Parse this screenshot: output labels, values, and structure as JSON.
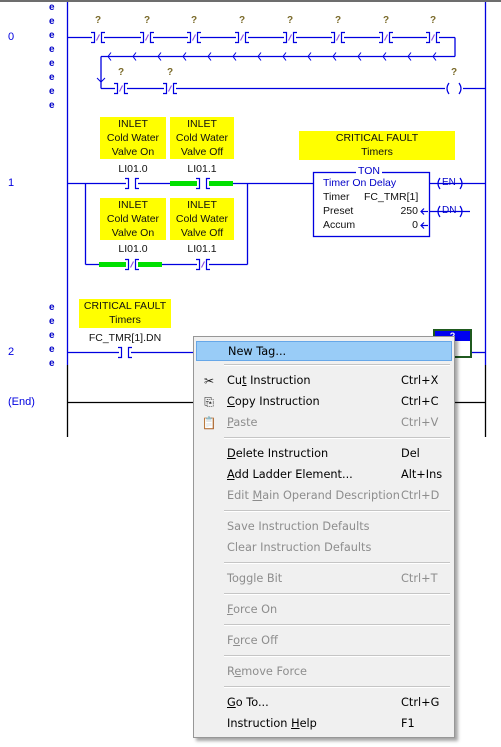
{
  "rungs": [
    {
      "number": "0",
      "error_marks": [
        "e",
        "e",
        "e",
        "e",
        "e",
        "e",
        "e",
        "e"
      ]
    },
    {
      "number": "1"
    },
    {
      "number": "2",
      "error_marks": [
        "e",
        "e",
        "e",
        "e",
        "e"
      ]
    },
    {
      "number": "(End)"
    }
  ],
  "rung0": {
    "top_contacts": [
      "?",
      "?",
      "?",
      "?",
      "?",
      "?",
      "?",
      "?"
    ],
    "bottom_contacts": [
      "?",
      "?"
    ],
    "coil": "?"
  },
  "rung1": {
    "contacts": [
      {
        "desc": [
          "INLET",
          "Cold Water",
          "Valve On"
        ],
        "operand": "LI01.0",
        "type": "XIC"
      },
      {
        "desc": [
          "INLET",
          "Cold Water",
          "Valve Off"
        ],
        "operand": "LI01.1",
        "type": "XIC"
      },
      {
        "desc": [
          "INLET",
          "Cold Water",
          "Valve On"
        ],
        "operand": "LI01.0",
        "type": "XIO"
      },
      {
        "desc": [
          "INLET",
          "Cold Water",
          "Valve Off"
        ],
        "operand": "LI01.1",
        "type": "XIO"
      }
    ],
    "ton": {
      "desc": [
        "CRITICAL FAULT",
        "Timers"
      ],
      "title": "TON",
      "name": "Timer On Delay",
      "timer_label": "Timer",
      "timer_value": "FC_TMR[1]",
      "preset_label": "Preset",
      "preset_value": "250",
      "accum_label": "Accum",
      "accum_value": "0",
      "en": "EN",
      "dn": "DN"
    }
  },
  "rung2": {
    "desc": [
      "CRITICAL FAULT",
      "Timers"
    ],
    "operand": "FC_TMR[1].DN",
    "coil": "?"
  },
  "context_menu": {
    "items": [
      {
        "pre": "New Tag...",
        "ul": "",
        "post": "",
        "shortcut": "",
        "icon": "",
        "disabled": false,
        "highlighted": true
      },
      {
        "pre": "Cu",
        "ul": "t",
        "post": " Instruction",
        "shortcut": "Ctrl+X",
        "icon": "scissors-icon",
        "disabled": false
      },
      {
        "pre": "",
        "ul": "C",
        "post": "opy Instruction",
        "shortcut": "Ctrl+C",
        "icon": "copy-icon",
        "disabled": false
      },
      {
        "pre": "",
        "ul": "P",
        "post": "aste",
        "shortcut": "Ctrl+V",
        "icon": "paste-icon",
        "disabled": true
      },
      {
        "pre": "",
        "ul": "D",
        "post": "elete Instruction",
        "shortcut": "Del",
        "icon": "",
        "disabled": false
      },
      {
        "pre": "",
        "ul": "A",
        "post": "dd Ladder Element...",
        "shortcut": "Alt+Ins",
        "icon": "",
        "disabled": false
      },
      {
        "pre": "Edit ",
        "ul": "M",
        "post": "ain Operand Description",
        "shortcut": "Ctrl+D",
        "icon": "",
        "disabled": true
      },
      {
        "pre": "Save Instruction Defaults",
        "ul": "",
        "post": "",
        "shortcut": "",
        "icon": "",
        "disabled": true
      },
      {
        "pre": "Clear Instruction Defaults",
        "ul": "",
        "post": "",
        "shortcut": "",
        "icon": "",
        "disabled": true
      },
      {
        "pre": "Toggle Bit",
        "ul": "",
        "post": "",
        "shortcut": "Ctrl+T",
        "icon": "",
        "disabled": true
      },
      {
        "pre": "",
        "ul": "F",
        "post": "orce On",
        "shortcut": "",
        "icon": "",
        "disabled": true
      },
      {
        "pre": "F",
        "ul": "o",
        "post": "rce Off",
        "shortcut": "",
        "icon": "",
        "disabled": true
      },
      {
        "pre": "R",
        "ul": "e",
        "post": "move Force",
        "shortcut": "",
        "icon": "",
        "disabled": true
      },
      {
        "pre": "",
        "ul": "G",
        "post": "o To...",
        "shortcut": "Ctrl+G",
        "icon": "",
        "disabled": false
      },
      {
        "pre": "Instruction ",
        "ul": "H",
        "post": "elp",
        "shortcut": "F1",
        "icon": "",
        "disabled": false
      }
    ]
  },
  "colors": {
    "wire": "#0000e0",
    "power_flow": "#00e000",
    "description_bg": "#ffff00",
    "menu_highlight": "#99ccf7"
  }
}
